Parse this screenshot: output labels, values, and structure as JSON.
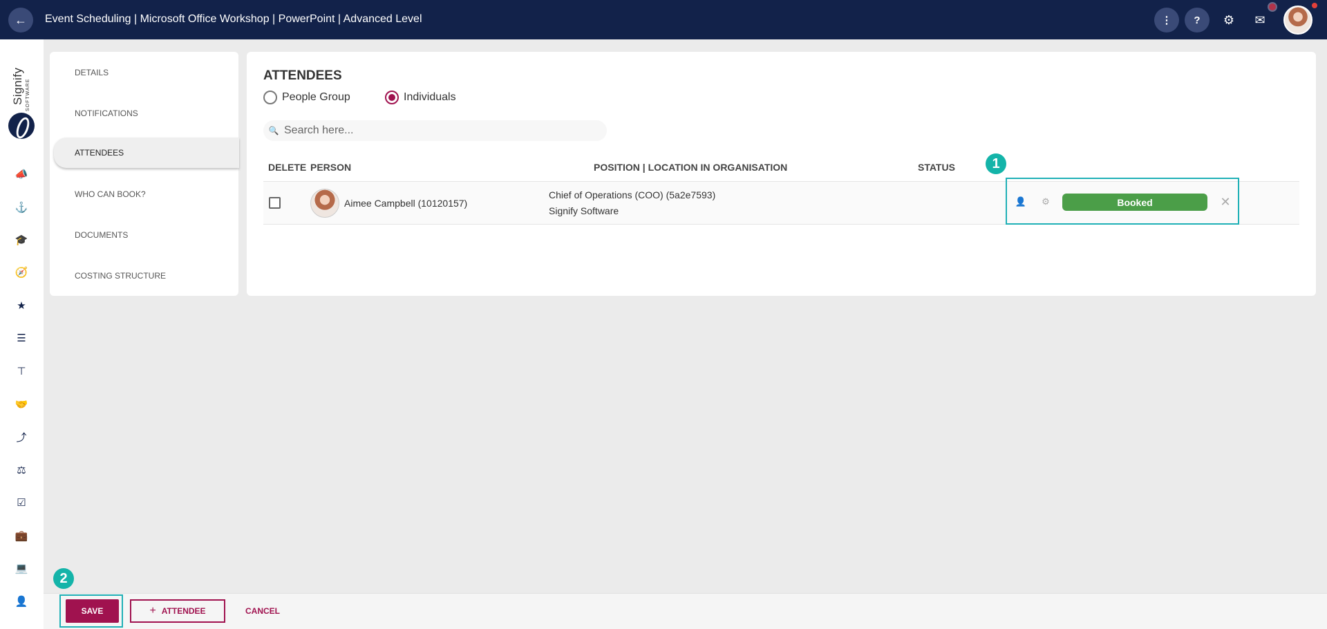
{
  "header": {
    "back_icon": "←",
    "title": "Event Scheduling | Microsoft Office Workshop | PowerPoint | Advanced Level",
    "more_icon": "⋮",
    "help_icon": "?",
    "settings_icon": "⚙",
    "inbox_icon": "✉"
  },
  "logo": {
    "name": "Signify",
    "sub": "SOFTWARE"
  },
  "rail_icons": [
    "📣",
    "⚓",
    "🎓",
    "🧭",
    "★",
    "☰",
    "⊤",
    "🤝",
    "⤴",
    "⚖",
    "☑",
    "💼",
    "💻",
    "👤"
  ],
  "sidebar": {
    "items": [
      {
        "label": "DETAILS"
      },
      {
        "label": "NOTIFICATIONS"
      },
      {
        "label": "ATTENDEES"
      },
      {
        "label": "WHO CAN BOOK?"
      },
      {
        "label": "DOCUMENTS"
      },
      {
        "label": "COSTING STRUCTURE"
      }
    ],
    "active": "ATTENDEES"
  },
  "attendees": {
    "title": "ATTENDEES",
    "radio_people_group": "People Group",
    "radio_individuals": "Individuals",
    "selected": "Individuals",
    "search_placeholder": "Search here...",
    "search_icon": "🔍",
    "columns": [
      "DELETE",
      "PERSON",
      "POSITION | LOCATION IN ORGANISATION",
      "STATUS"
    ],
    "rows": [
      {
        "person": "Aimee Campbell (10120157)",
        "position": "Chief of Operations (COO) (5a2e7593)",
        "location": "Signify Software",
        "status": "Booked",
        "checked": false
      }
    ]
  },
  "status_icons": {
    "person": "👤",
    "person_settings": "⚙",
    "remove": "✕"
  },
  "badges": {
    "one": "1",
    "two": "2"
  },
  "colors": {
    "header_bg": "#12224a",
    "accent": "#a0124f",
    "booked": "#4b9e48",
    "highlight": "#1fb0b6",
    "badge": "#14b4a9"
  },
  "footer": {
    "save_label": "SAVE",
    "attendee_label": "ATTENDEE",
    "attendee_icon": "+",
    "cancel_label": "CANCEL"
  }
}
